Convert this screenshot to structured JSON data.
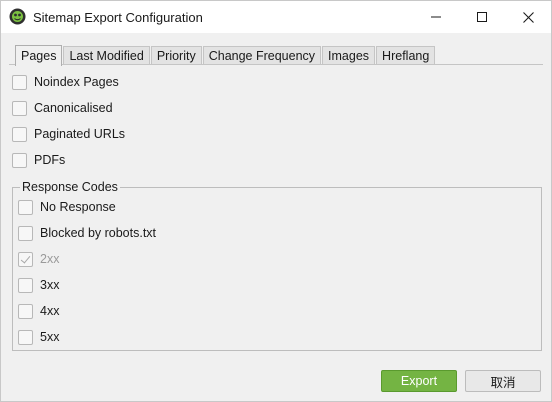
{
  "window": {
    "title": "Sitemap Export Configuration",
    "icons": {
      "app": "frog-app-icon",
      "minimize": "minimize-icon",
      "maximize": "maximize-icon",
      "close": "close-icon"
    }
  },
  "tabs": [
    {
      "label": "Pages",
      "active": true
    },
    {
      "label": "Last Modified",
      "active": false
    },
    {
      "label": "Priority",
      "active": false
    },
    {
      "label": "Change Frequency",
      "active": false
    },
    {
      "label": "Images",
      "active": false
    },
    {
      "label": "Hreflang",
      "active": false
    }
  ],
  "page_options": [
    {
      "label": "Noindex Pages",
      "checked": false
    },
    {
      "label": "Canonicalised",
      "checked": false
    },
    {
      "label": "Paginated URLs",
      "checked": false
    },
    {
      "label": "PDFs",
      "checked": false
    }
  ],
  "response_codes": {
    "title": "Response Codes",
    "items": [
      {
        "label": "No Response",
        "checked": false,
        "disabled": false
      },
      {
        "label": "Blocked by robots.txt",
        "checked": false,
        "disabled": false
      },
      {
        "label": "2xx",
        "checked": true,
        "disabled": true
      },
      {
        "label": "3xx",
        "checked": false,
        "disabled": false
      },
      {
        "label": "4xx",
        "checked": false,
        "disabled": false
      },
      {
        "label": "5xx",
        "checked": false,
        "disabled": false
      }
    ]
  },
  "buttons": {
    "export": "Export",
    "cancel": "取消"
  },
  "colors": {
    "accent": "#74b443",
    "disabled_text": "#9a9a9a"
  }
}
